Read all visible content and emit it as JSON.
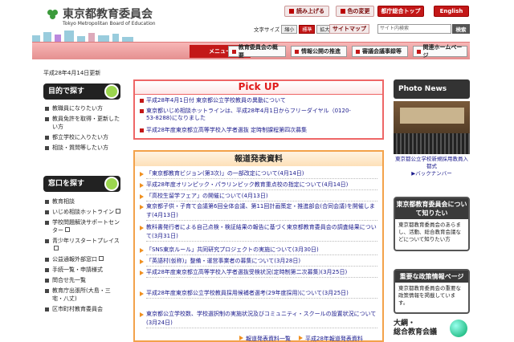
{
  "header": {
    "logo_title": "東京都教育委員会",
    "logo_en": "Tokyo Metropolitan Board of Education",
    "util_read": "読み上げる",
    "util_color": "色の変更",
    "util_tokyo": "都庁総合トップ",
    "util_english": "English",
    "font_size_label": "文字サイズ",
    "font_small": "縮小",
    "font_standard": "標準",
    "font_large": "拡大",
    "sitemap": "サイトマップ",
    "search_placeholder": "サイト内検索",
    "search_button": "検索"
  },
  "nav": {
    "menu_label": "メニュー",
    "items": [
      "教育委員会の概要",
      "情報公開の推進",
      "審議会議事録等",
      "関連ホームページ"
    ]
  },
  "updated": "平成28年4月14日更新",
  "sidebar": {
    "purpose_head": "目的で探す",
    "purpose_items": [
      {
        "label": "教職員になりたい方",
        "ext": false
      },
      {
        "label": "教員免許を取得・更新したい方",
        "ext": false
      },
      {
        "label": "都立学校に入りたい方",
        "ext": false
      },
      {
        "label": "相談・質問等したい方",
        "ext": false
      }
    ],
    "window_head": "窓口を探す",
    "window_items": [
      {
        "label": "教育相談",
        "ext": false
      },
      {
        "label": "いじめ相談ホットライン",
        "ext": true
      },
      {
        "label": "学校問題解決サポートセンター",
        "ext": true
      },
      {
        "label": "青少年リスタートプレイス",
        "ext": true
      },
      {
        "label": "公益通報外部窓口",
        "ext": true
      },
      {
        "label": "手続一覧・申請様式",
        "ext": false
      },
      {
        "label": "問合せ先一覧",
        "ext": false
      },
      {
        "label": "教育庁出張所(大島・三宅・八丈)",
        "ext": false
      },
      {
        "label": "区市町村教育委員会",
        "ext": false
      }
    ]
  },
  "pickup": {
    "title": "Pick UP",
    "items": [
      "平成28年4月1日付 東京都公立学校教員の異動について",
      "東京都いじめ相談ホットラインは、平成28年4月1日からフリーダイヤル（0120-53-8288)になりました",
      "平成28年度東京都立高等学校入学者選抜 定時制課程第四次募集"
    ]
  },
  "press": {
    "title": "報道発表資料",
    "items": [
      "「東京都教育ビジョン(第3次)」の一部改定について(4月14日)",
      "平成28年度オリンピック・パラリンピック教育重点校の指定について(4月14日)",
      "「高校生留学フェア」の開催について(4月13日)",
      "東京都子供・子育て会議第6回全体会議、第11回計画策定・推進部会(合同会議)を開催します(4月13日)",
      "教科書発行者による自己点検・検証結果の報告に基づく東京都教育委員会の調査結果について(3月31日)",
      "「SNS東京ルール」共同研究プロジェクトの実施について(3月30日)",
      "「英語村(仮称)」整備・運営事業者の募集について(3月28日)",
      "平成28年度東京都立高等学校入学者選抜受検状況(定時制第二次募集)(3月25日)",
      "平成28年度東京都公立学校教員採用候補者選考(29年度採用)について(3月25日)",
      "東京都公立学校数、学校選択制の実施状況及びコミュニティ・スクールの設置状況について(3月24日)"
    ],
    "link_list": "報道発表資料一覧",
    "link_year": "平成28年報道発表資料"
  },
  "right": {
    "photo_head": "Photo News",
    "photo_caption": "東京都公立学校新規採用教員入都式",
    "photo_backnumber": "▶バックナンバー",
    "board_head": "東京都教育委員会について知りたい",
    "board_body": "東京都教育委員会のあらまし、活動、総合教育会議などについて知りたい方",
    "policy_head": "重要な政策情報ページ",
    "policy_body": "東京都教育委員会の重要な政策情報を掲載しています。",
    "taiko_line1": "大綱・",
    "taiko_line2": "総合教育会議"
  },
  "colors": {
    "accent_red": "#c31818",
    "nav_pink": "#e58f8f",
    "press_orange": "#f3a24a",
    "link_blue": "#1a1a8c"
  }
}
